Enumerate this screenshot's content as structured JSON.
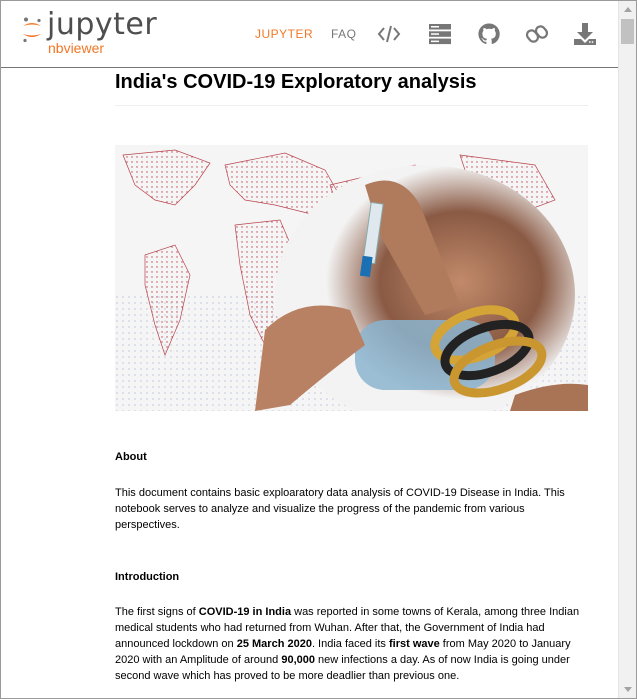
{
  "brand": {
    "name": "jupyter",
    "subtitle": "nbviewer"
  },
  "nav": {
    "jupyter": "JUPYTER",
    "faq": "FAQ",
    "icons": [
      "code-icon",
      "server-icon",
      "github-icon",
      "link-icon",
      "download-icon"
    ]
  },
  "colors": {
    "accent": "#f37726",
    "nav_gray": "#777777"
  },
  "notebook": {
    "title": "India's COVID-19 Exploratory analysis",
    "about_heading": "About",
    "about_text": "This document contains basic exploaratory data analysis of COVID-19 Disease in India. This notebook serves to analyze and visualize the progress of the pandemic from various perspectives.",
    "intro_heading": "Introduction",
    "intro": {
      "t1": "The first signs of ",
      "b1": "COVID-19 in India",
      "t2": " was reported in some towns of Kerala, among three Indian medical students who had returned from Wuhan. After that, the Government of India had announced lockdown on ",
      "b2": "25 March 2020",
      "t3": ". India faced its ",
      "b3": "first wave",
      "t4": " from May 2020 to January 2020 with an Amplitude of around ",
      "b4": "90,000",
      "t5": " new infections a day. As of now India is going under second wave which has proved to be more deadlier than previous one."
    }
  }
}
